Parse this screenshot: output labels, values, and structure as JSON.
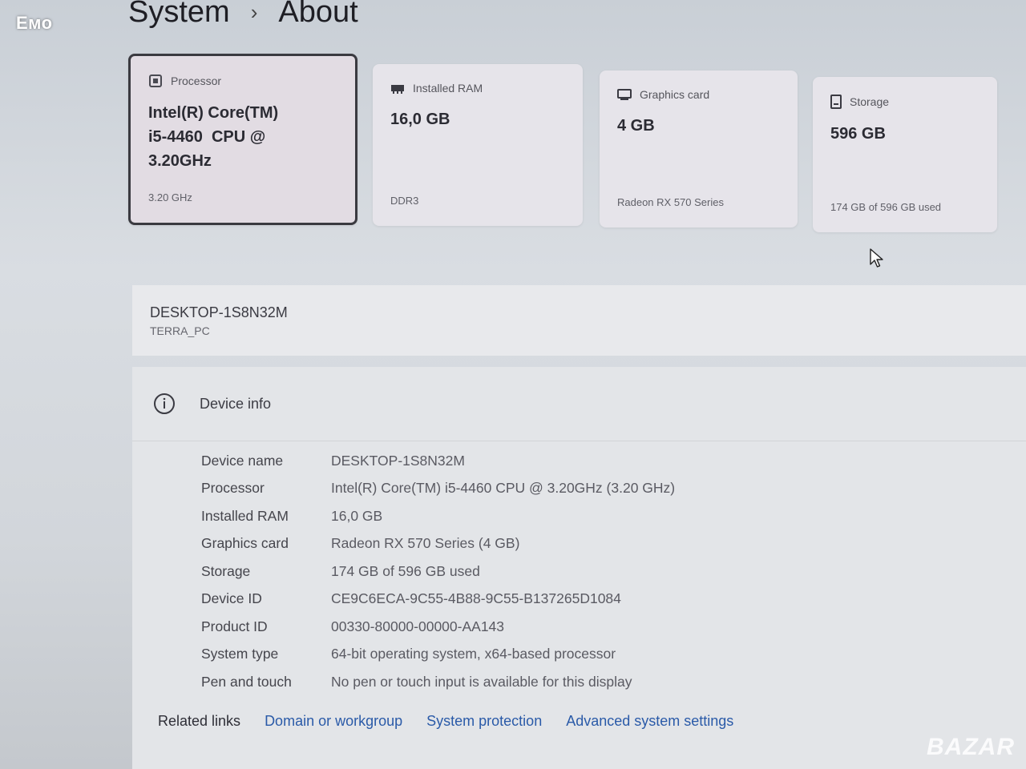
{
  "corner_label": "Емо",
  "breadcrumb": {
    "parent": "System",
    "separator": "›",
    "current": "About"
  },
  "cards": {
    "processor": {
      "icon": "chip-icon",
      "title": "Processor",
      "value_lines": [
        "Intel(R) Core(TM)",
        "i5-4460  CPU @",
        "3.20GHz"
      ],
      "sub": "3.20 GHz"
    },
    "ram": {
      "icon": "ram-icon",
      "title": "Installed RAM",
      "value": "16,0 GB",
      "sub": "DDR3"
    },
    "graphics": {
      "icon": "gpu-icon",
      "title": "Graphics card",
      "value": "4 GB",
      "sub": "Radeon RX 570 Series"
    },
    "storage": {
      "icon": "storage-icon",
      "title": "Storage",
      "value": "596 GB",
      "sub": "174 GB of 596 GB used"
    }
  },
  "pc": {
    "name": "DESKTOP-1S8N32M",
    "alias": "TERRA_PC"
  },
  "device_info": {
    "header": "Device info",
    "rows": [
      {
        "key": "Device name",
        "value": "DESKTOP-1S8N32M"
      },
      {
        "key": "Processor",
        "value": "Intel(R) Core(TM) i5-4460 CPU @ 3.20GHz (3.20 GHz)"
      },
      {
        "key": "Installed RAM",
        "value": "16,0 GB"
      },
      {
        "key": "Graphics card",
        "value": "Radeon RX 570 Series (4 GB)"
      },
      {
        "key": "Storage",
        "value": "174 GB of 596 GB used"
      },
      {
        "key": "Device ID",
        "value": "CE9C6ECA-9C55-4B88-9C55-B137265D1084"
      },
      {
        "key": "Product ID",
        "value": "00330-80000-00000-AA143"
      },
      {
        "key": "System type",
        "value": "64-bit operating system, x64-based processor"
      },
      {
        "key": "Pen and touch",
        "value": "No pen or touch input is available for this display"
      }
    ]
  },
  "related_links": {
    "label": "Related links",
    "links": [
      "Domain or workgroup",
      "System protection",
      "Advanced system settings"
    ]
  },
  "watermark": "BAZAR"
}
